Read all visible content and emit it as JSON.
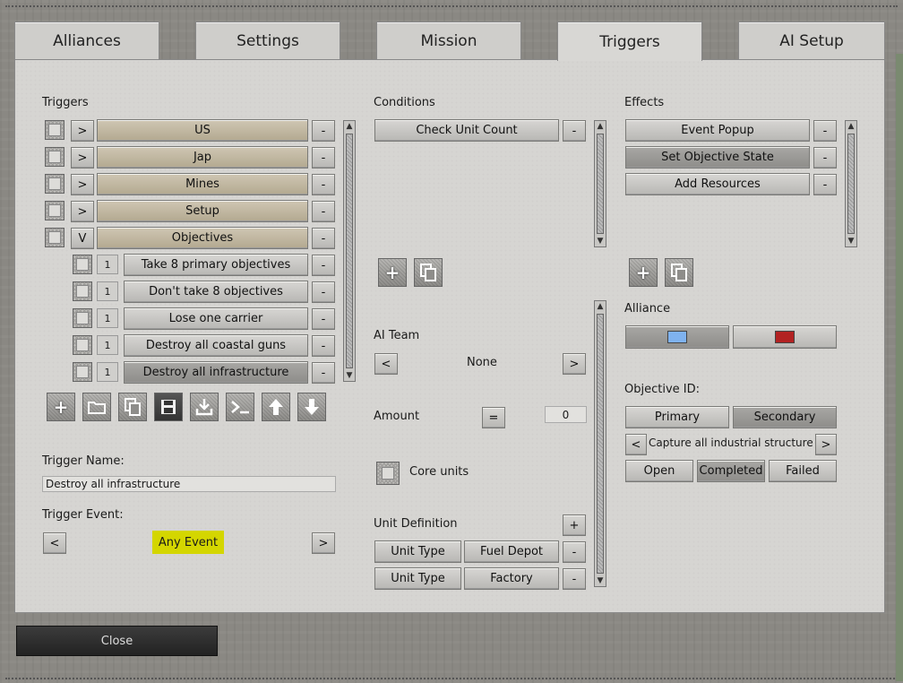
{
  "tabs": [
    "Alliances",
    "Settings",
    "Mission",
    "Triggers",
    "AI Setup"
  ],
  "triggers": {
    "label": "Triggers",
    "groups": [
      {
        "arrow": ">",
        "name": "US"
      },
      {
        "arrow": ">",
        "name": "Jap"
      },
      {
        "arrow": ">",
        "name": "Mines"
      },
      {
        "arrow": ">",
        "name": "Setup"
      },
      {
        "arrow": "V",
        "name": "Objectives"
      }
    ],
    "children": [
      {
        "num": "1",
        "name": "Take 8 primary objectives"
      },
      {
        "num": "1",
        "name": "Don't take 8 objectives"
      },
      {
        "num": "1",
        "name": "Lose one carrier"
      },
      {
        "num": "1",
        "name": "Destroy all coastal guns"
      },
      {
        "num": "1",
        "name": "Destroy all infrastructure"
      }
    ],
    "minus": "-",
    "toolbar_icons": [
      "plus-icon",
      "folder-icon",
      "copy-icon",
      "save-icon",
      "import-icon",
      "console-icon",
      "arrow-up-icon",
      "arrow-down-icon"
    ],
    "name_label": "Trigger Name:",
    "name_value": "Destroy all infrastructure",
    "event_label": "Trigger Event:",
    "event_value": "Any Event",
    "prev": "<",
    "next": ">"
  },
  "conditions": {
    "label": "Conditions",
    "items": [
      "Check Unit Count"
    ],
    "ai_team_label": "AI Team",
    "ai_team_value": "None",
    "amount_label": "Amount",
    "amount_op": "=",
    "amount_value": "0",
    "core_units_label": "Core units",
    "unit_def_label": "Unit Definition",
    "add": "+",
    "unit_defs": [
      {
        "type": "Unit Type",
        "value": "Fuel Depot"
      },
      {
        "type": "Unit Type",
        "value": "Factory"
      }
    ]
  },
  "effects": {
    "label": "Effects",
    "items": [
      "Event Popup",
      "Set Objective State",
      "Add Resources"
    ],
    "alliance_label": "Alliance",
    "alliance_colors": [
      "#7fb2ef",
      "#b22222"
    ],
    "objective_label": "Objective ID:",
    "objective_types": [
      "Primary",
      "Secondary"
    ],
    "objective_name": "Capture all industrial structure",
    "states": [
      "Open",
      "Completed",
      "Failed"
    ]
  },
  "close_label": "Close"
}
